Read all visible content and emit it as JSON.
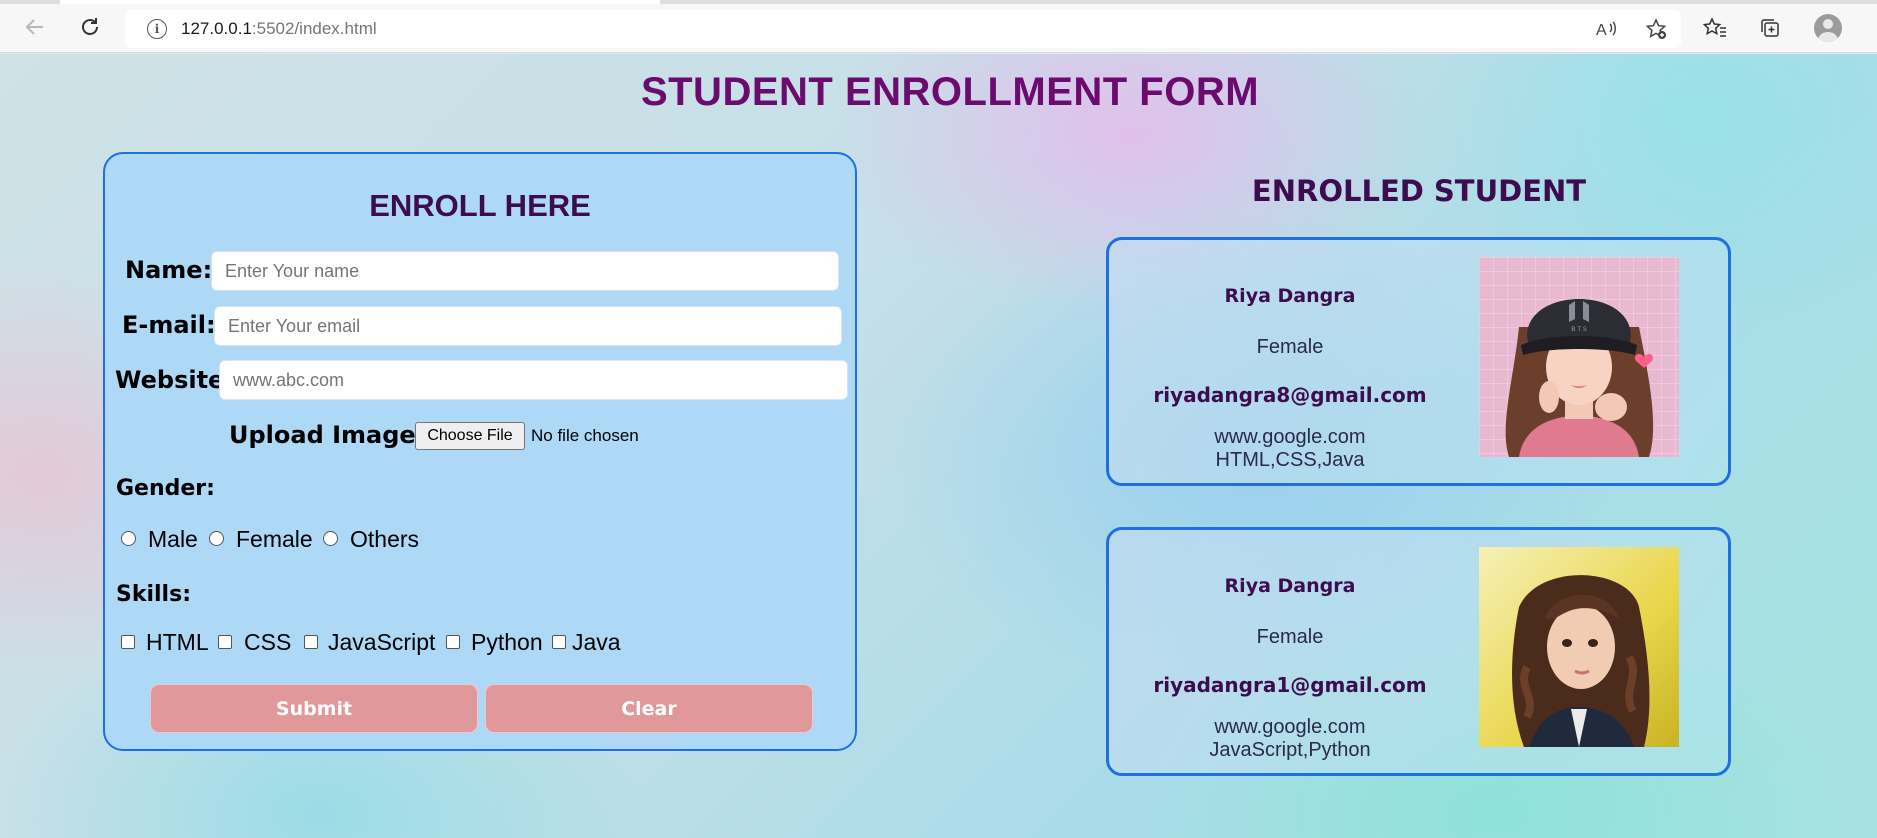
{
  "browser": {
    "url_host": "127.0.0.1",
    "url_rest": ":5502/index.html",
    "back_icon": "arrow-left-icon",
    "refresh_icon": "refresh-icon",
    "info_icon": "info-icon",
    "read_aloud_icon": "read-aloud-icon",
    "favorite_add_icon": "star-add-icon",
    "favorites_icon": "favorites-icon",
    "collections_icon": "collections-icon",
    "profile_icon": "profile-avatar-icon"
  },
  "page": {
    "title": "STUDENT ENROLLMENT FORM"
  },
  "form": {
    "heading": "ENROLL HERE",
    "name_label": "Name:",
    "name_placeholder": "Enter Your name",
    "email_label": "E-mail:",
    "email_placeholder": "Enter Your email",
    "website_label": "Website",
    "website_placeholder": "www.abc.com",
    "upload_label": "Upload Image:",
    "file_button": "Choose File",
    "file_status": "No file chosen",
    "gender_label": "Gender:",
    "gender_options": [
      "Male",
      "Female",
      "Others"
    ],
    "skills_label": "Skills:",
    "skill_options": [
      "HTML",
      "CSS",
      "JavaScript",
      "Python",
      "Java"
    ],
    "submit_label": "Submit",
    "clear_label": "Clear"
  },
  "enrolled": {
    "heading": "ENROLLED STUDENT",
    "students": [
      {
        "name": "Riya Dangra",
        "gender": "Female",
        "email": "riyadangra8@gmail.com",
        "website": "www.google.com",
        "skills": "HTML,CSS,Java",
        "photo": "cartoon-girl-bts-cap-photo"
      },
      {
        "name": "Riya Dangra",
        "gender": "Female",
        "email": "riyadangra1@gmail.com",
        "website": "www.google.com",
        "skills": "JavaScript,Python",
        "photo": "girl-portrait-photo"
      }
    ]
  },
  "colors": {
    "title": "#6a0b6d",
    "heading": "#3d0c4f",
    "card_border": "#1f6fe0",
    "form_bg": "#add8f6",
    "button_bg": "#e0989b"
  }
}
